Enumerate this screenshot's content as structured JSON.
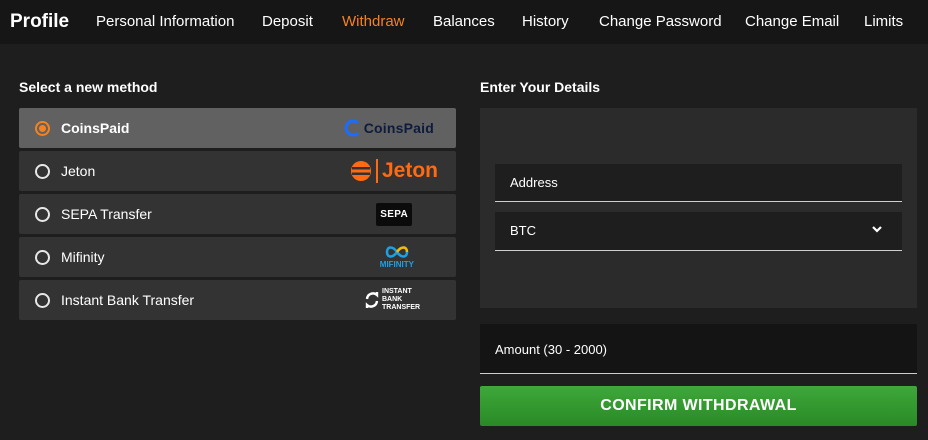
{
  "header": {
    "brand": "Profile",
    "nav": [
      {
        "label": "Personal Information",
        "active": false
      },
      {
        "label": "Deposit",
        "active": false
      },
      {
        "label": "Withdraw",
        "active": true
      },
      {
        "label": "Balances",
        "active": false
      },
      {
        "label": "History",
        "active": false
      },
      {
        "label": "Change Password",
        "active": false
      },
      {
        "label": "Change Email",
        "active": false
      },
      {
        "label": "Limits",
        "active": false
      }
    ]
  },
  "methods": {
    "heading": "Select a new method",
    "selected": "CoinsPaid",
    "items": [
      {
        "label": "CoinsPaid",
        "logo_text": "CoinsPaid",
        "logo_icon": "coinspaid-logo"
      },
      {
        "label": "Jeton",
        "logo_text": "Jeton",
        "logo_icon": "jeton-logo"
      },
      {
        "label": "SEPA Transfer",
        "logo_text": "SEPA",
        "logo_icon": "sepa-logo"
      },
      {
        "label": "Mifinity",
        "logo_text": "MIFINITY",
        "logo_icon": "mifinity-logo"
      },
      {
        "label": "Instant Bank Transfer",
        "logo_text": "INSTANT BANK TRANSFER",
        "logo_icon": "instant-bank-transfer-logo"
      }
    ]
  },
  "details": {
    "heading": "Enter Your Details",
    "address_label": "Address",
    "currency_value": "BTC",
    "amount_label": "Amount (30 - 2000)",
    "confirm_label": "CONFIRM WITHDRAWAL"
  },
  "colors": {
    "accent": "#f58220",
    "confirm_green": "#34a030",
    "background": "#1e1e1e",
    "coinspaid_blue": "#1b6cff",
    "jeton_orange": "#ff6a13",
    "mifinity_blue": "#1ea0e6"
  }
}
